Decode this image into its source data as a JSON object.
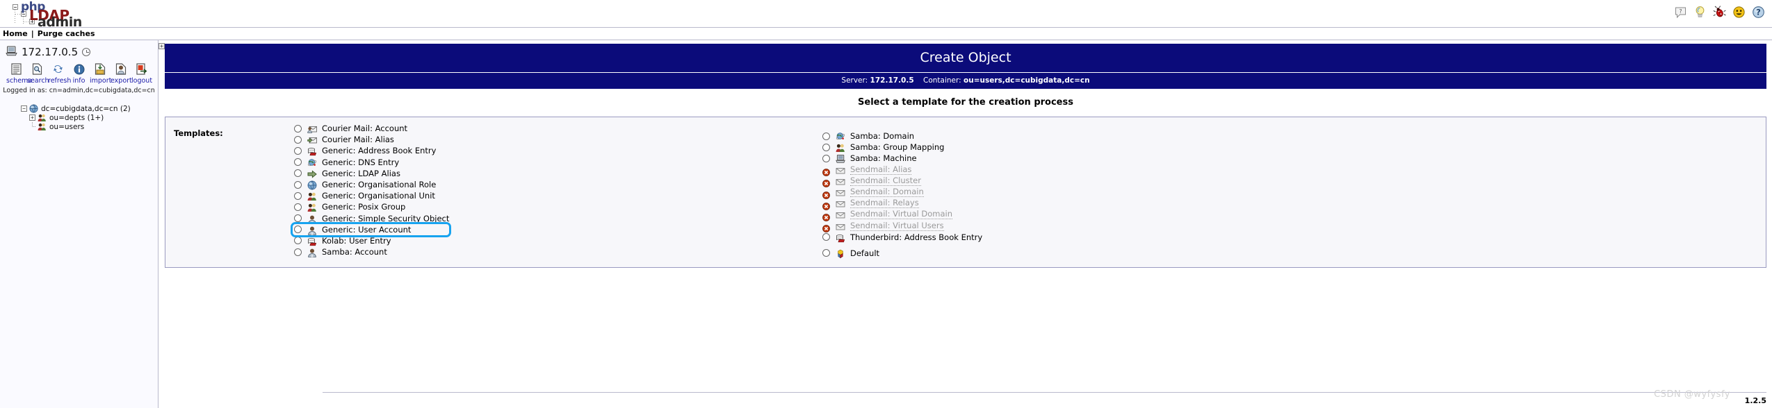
{
  "app": {
    "logo": {
      "line1": "php",
      "line2": "LDAP",
      "line3": "admin"
    },
    "version": "1.2.5",
    "watermark": "CSDN @wyfysfy"
  },
  "topbar": {
    "icons": [
      {
        "name": "help-bubble-icon",
        "label": "?"
      },
      {
        "name": "lightbulb-icon",
        "label": "hint"
      },
      {
        "name": "bug-icon",
        "label": "report bug"
      },
      {
        "name": "smiley-icon",
        "label": "feedback"
      },
      {
        "name": "question-globe-icon",
        "label": "help"
      }
    ]
  },
  "breadcrumb": {
    "home": "Home",
    "separator": "|",
    "purge": "Purge caches"
  },
  "sidebar": {
    "server_ip": "172.17.0.5",
    "toolbar": [
      {
        "label": "schema",
        "icon": "schema-icon"
      },
      {
        "label": "search",
        "icon": "search-icon"
      },
      {
        "label": "refresh",
        "icon": "refresh-icon"
      },
      {
        "label": "info",
        "icon": "info-icon"
      },
      {
        "label": "import",
        "icon": "import-icon"
      },
      {
        "label": "export",
        "icon": "export-icon"
      },
      {
        "label": "logout",
        "icon": "logout-icon"
      }
    ],
    "logged_in_as": "Logged in as: cn=admin,dc=cubigdata,dc=cn",
    "tree": [
      {
        "label": "dc=cubigdata,dc=cn (2)",
        "icon": "globe-icon",
        "expander": "-",
        "level": 1
      },
      {
        "label": "ou=depts (1+)",
        "icon": "users-icon",
        "expander": "+",
        "level": 2
      },
      {
        "label": "ou=users",
        "icon": "users-icon",
        "expander": "",
        "level": 2
      }
    ]
  },
  "main": {
    "title": "Create Object",
    "server_label": "Server:",
    "server_value": "172.17.0.5",
    "container_label": "Container:",
    "container_value": "ou=users,dc=cubigdata,dc=cn",
    "select_heading": "Select a template for the creation process",
    "templates_label": "Templates:",
    "templates_left": [
      {
        "label": "Courier Mail: Account",
        "icon": "mail-user-icon",
        "disabled": false,
        "selected": false,
        "highlighted": false
      },
      {
        "label": "Courier Mail: Alias",
        "icon": "mail-arrow-icon",
        "disabled": false,
        "selected": false,
        "highlighted": false
      },
      {
        "label": "Generic: Address Book Entry",
        "icon": "addressbook-icon",
        "disabled": false,
        "selected": false,
        "highlighted": false
      },
      {
        "label": "Generic: DNS Entry",
        "icon": "dns-icon",
        "disabled": false,
        "selected": false,
        "highlighted": false
      },
      {
        "label": "Generic: LDAP Alias",
        "icon": "arrow-icon",
        "disabled": false,
        "selected": false,
        "highlighted": false
      },
      {
        "label": "Generic: Organisational Role",
        "icon": "globe-icon",
        "disabled": false,
        "selected": false,
        "highlighted": false
      },
      {
        "label": "Generic: Organisational Unit",
        "icon": "users-icon",
        "disabled": false,
        "selected": false,
        "highlighted": false
      },
      {
        "label": "Generic: Posix Group",
        "icon": "users-icon",
        "disabled": false,
        "selected": false,
        "highlighted": false
      },
      {
        "label": "Generic: Simple Security Object",
        "icon": "user-icon",
        "disabled": false,
        "selected": false,
        "highlighted": false
      },
      {
        "label": "Generic: User Account",
        "icon": "user-icon",
        "disabled": false,
        "selected": false,
        "highlighted": true
      },
      {
        "label": "Kolab: User Entry",
        "icon": "addressbook-icon",
        "disabled": false,
        "selected": false,
        "highlighted": false
      },
      {
        "label": "Samba: Account",
        "icon": "user-icon",
        "disabled": false,
        "selected": false,
        "highlighted": false
      }
    ],
    "templates_right": [
      {
        "label": "Samba: Domain",
        "icon": "dns-icon",
        "disabled": false,
        "selected": false,
        "highlighted": false
      },
      {
        "label": "Samba: Group Mapping",
        "icon": "users-icon",
        "disabled": false,
        "selected": false,
        "highlighted": false
      },
      {
        "label": "Samba: Machine",
        "icon": "computer-icon",
        "disabled": false,
        "selected": false,
        "highlighted": false
      },
      {
        "label": "Sendmail: Alias",
        "icon": "envelope-icon",
        "disabled": true,
        "selected": false,
        "highlighted": false
      },
      {
        "label": "Sendmail: Cluster",
        "icon": "envelope-icon",
        "disabled": true,
        "selected": false,
        "highlighted": false
      },
      {
        "label": "Sendmail: Domain",
        "icon": "envelope-icon",
        "disabled": true,
        "selected": false,
        "highlighted": false
      },
      {
        "label": "Sendmail: Relays",
        "icon": "envelope-icon",
        "disabled": true,
        "selected": false,
        "highlighted": false
      },
      {
        "label": "Sendmail: Virtual Domain",
        "icon": "envelope-icon",
        "disabled": true,
        "selected": false,
        "highlighted": false
      },
      {
        "label": "Sendmail: Virtual Users",
        "icon": "envelope-icon",
        "disabled": true,
        "selected": false,
        "highlighted": false
      },
      {
        "label": "Thunderbird: Address Book Entry",
        "icon": "addressbook-icon",
        "disabled": false,
        "selected": false,
        "highlighted": false
      },
      {
        "label": "Default",
        "icon": "default-icon",
        "disabled": false,
        "selected": false,
        "highlighted": false
      }
    ]
  },
  "colors": {
    "header_blue": "#0b0b7a",
    "link_blue": "#1a1aa8",
    "highlight": "#17a3ef",
    "panel_bg": "#f7f7fa",
    "border": "#9a9ac0"
  }
}
